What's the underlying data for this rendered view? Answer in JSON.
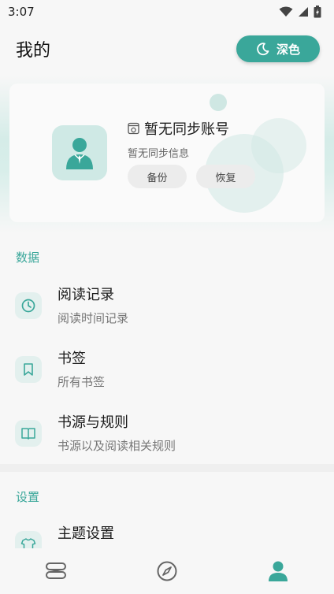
{
  "status_bar": {
    "time": "3:07"
  },
  "header": {
    "title": "我的",
    "theme_label": "深色"
  },
  "profile": {
    "account_name": "暂无同步账号",
    "sync_info": "暂无同步信息",
    "backup_label": "备份",
    "restore_label": "恢复"
  },
  "sections": {
    "data": {
      "title": "数据",
      "items": [
        {
          "title": "阅读记录",
          "subtitle": "阅读时间记录"
        },
        {
          "title": "书签",
          "subtitle": "所有书签"
        },
        {
          "title": "书源与规则",
          "subtitle": "书源以及阅读相关规则"
        }
      ]
    },
    "settings": {
      "title": "设置",
      "items": [
        {
          "title": "主题设置"
        }
      ]
    }
  },
  "colors": {
    "accent": "#3aa79a",
    "icon_bg": "#e3f0ee"
  },
  "bottom_nav": {
    "tabs": [
      {
        "icon": "bookshelf-icon",
        "active": false
      },
      {
        "icon": "compass-icon",
        "active": false
      },
      {
        "icon": "person-icon",
        "active": true
      }
    ]
  }
}
